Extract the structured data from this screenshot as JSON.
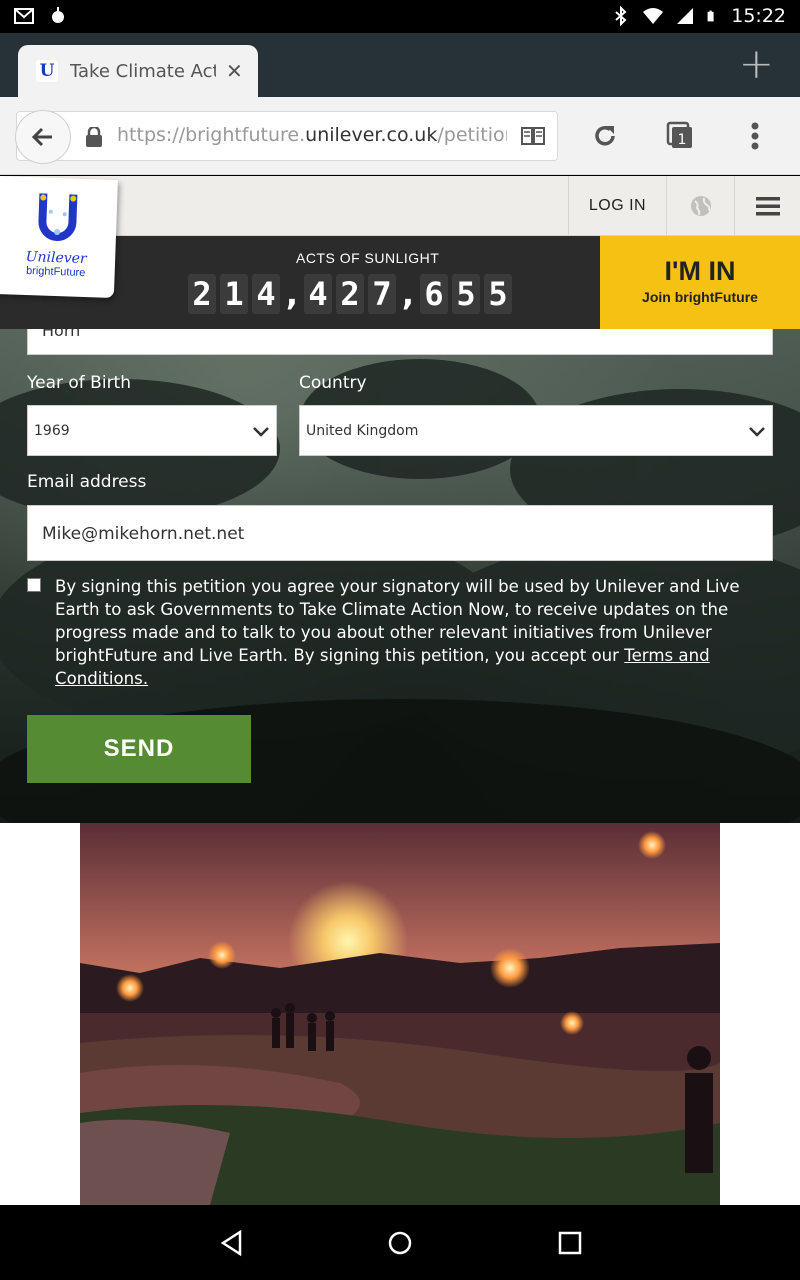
{
  "status_bar": {
    "time": "15:22"
  },
  "browser": {
    "tab_title": "Take Climate Act",
    "url_prefix": "https://brightfuture.",
    "url_domain": "unilever.co.uk",
    "url_suffix": "/petition",
    "tab_count": "1"
  },
  "site": {
    "logo_brand": "Unilever",
    "logo_sub": "brightFuture",
    "login": "LOG IN",
    "counter_label": "ACTS OF SUNLIGHT",
    "counter_value": "214,427,655",
    "cta_title": "I'M IN",
    "cta_sub": "Join brightFuture"
  },
  "form": {
    "top_field_value": "Horn",
    "year_label": "Year of Birth",
    "year_value": "1969",
    "country_label": "Country",
    "country_value": "United Kingdom",
    "email_label": "Email address",
    "email_value": "Mike@mikehorn.net.net",
    "consent_text": "By signing this petition you agree your signatory will be used by Unilever and Live Earth to ask Governments to Take Climate Action Now, to receive updates on the progress made and to talk to you about other relevant initiatives from Unilever brightFuture and Live Earth. By signing this petition, you accept our ",
    "terms_link": "Terms and Conditions.",
    "send_label": "SEND"
  },
  "colors": {
    "cta_yellow": "#f5c112",
    "send_green": "#548b33",
    "brand_blue": "#1f36c7"
  }
}
